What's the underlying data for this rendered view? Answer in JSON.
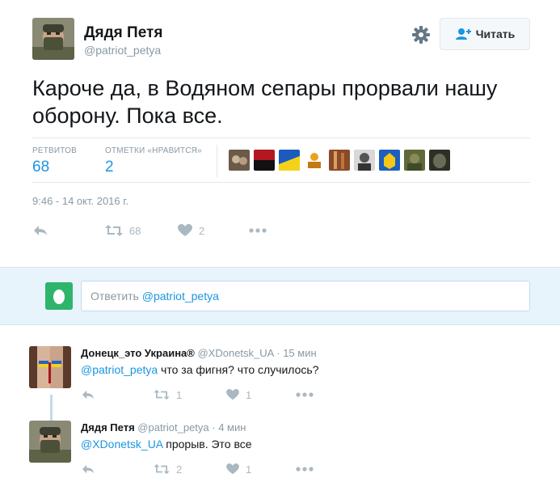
{
  "tweet": {
    "author_name": "Дядя Петя",
    "author_handle": "@patriot_petya",
    "follow_label": "Читать",
    "text": "Кароче да, в Водяном сепары прорвали нашу оборону. Пока все.",
    "retweets_label": "РЕТВИТОВ",
    "retweets_value": "68",
    "likes_label": "ОТМЕТКИ «НРАВИТСЯ»",
    "likes_value": "2",
    "timestamp": "9:46 - 14 окт. 2016 г.",
    "action_retweet_count": "68",
    "action_like_count": "2",
    "likers_icons": [
      "liker-avatar-1",
      "liker-avatar-2",
      "liker-avatar-3",
      "liker-avatar-4",
      "liker-avatar-5",
      "liker-avatar-6",
      "liker-avatar-7",
      "liker-avatar-8",
      "liker-avatar-9"
    ]
  },
  "reply_box": {
    "prefix": "Ответить ",
    "mention": "@patriot_petya"
  },
  "replies": [
    {
      "name": "Донецк_это Украина®",
      "handle": "@XDonetsk_UA",
      "time": "· 15 мин",
      "mention": "@patriot_petya",
      "text": " что за фигня? что случилось?",
      "retweets": "1",
      "likes": "1"
    },
    {
      "name": "Дядя Петя",
      "handle": "@patriot_petya",
      "time": "· 4 мин",
      "mention": "@XDonetsk_UA",
      "text": " прорыв. Это все",
      "retweets": "2",
      "likes": "1"
    }
  ],
  "colors": {
    "accent": "#1b95e0",
    "muted": "#8899a6",
    "reply_bg": "#e8f4fb"
  }
}
